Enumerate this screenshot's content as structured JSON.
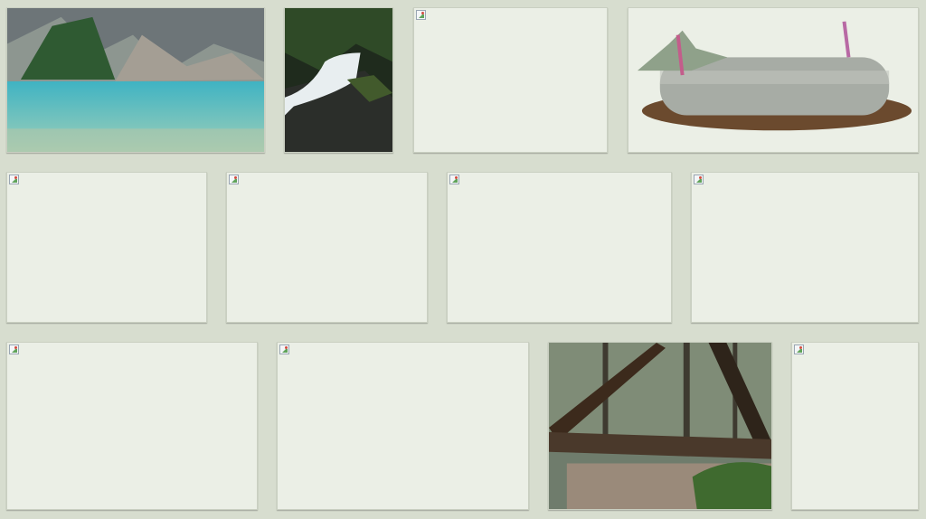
{
  "gallery": {
    "tiles": [
      {
        "id": "t1",
        "kind": "photo",
        "subject": "mountain-lake"
      },
      {
        "id": "t2",
        "kind": "photo",
        "subject": "waterfall"
      },
      {
        "id": "t3",
        "kind": "broken-image"
      },
      {
        "id": "t4",
        "kind": "photo",
        "subject": "log-with-ferns"
      },
      {
        "id": "t5",
        "kind": "broken-image"
      },
      {
        "id": "t6",
        "kind": "broken-image"
      },
      {
        "id": "t7",
        "kind": "broken-image"
      },
      {
        "id": "t8",
        "kind": "broken-image"
      },
      {
        "id": "t9",
        "kind": "broken-image"
      },
      {
        "id": "t10",
        "kind": "broken-image"
      },
      {
        "id": "t11",
        "kind": "photo",
        "subject": "forest-fallen-log"
      },
      {
        "id": "t12",
        "kind": "broken-image"
      }
    ]
  },
  "colors": {
    "background": "#d7ddcf",
    "tile": "#ebefe6"
  }
}
